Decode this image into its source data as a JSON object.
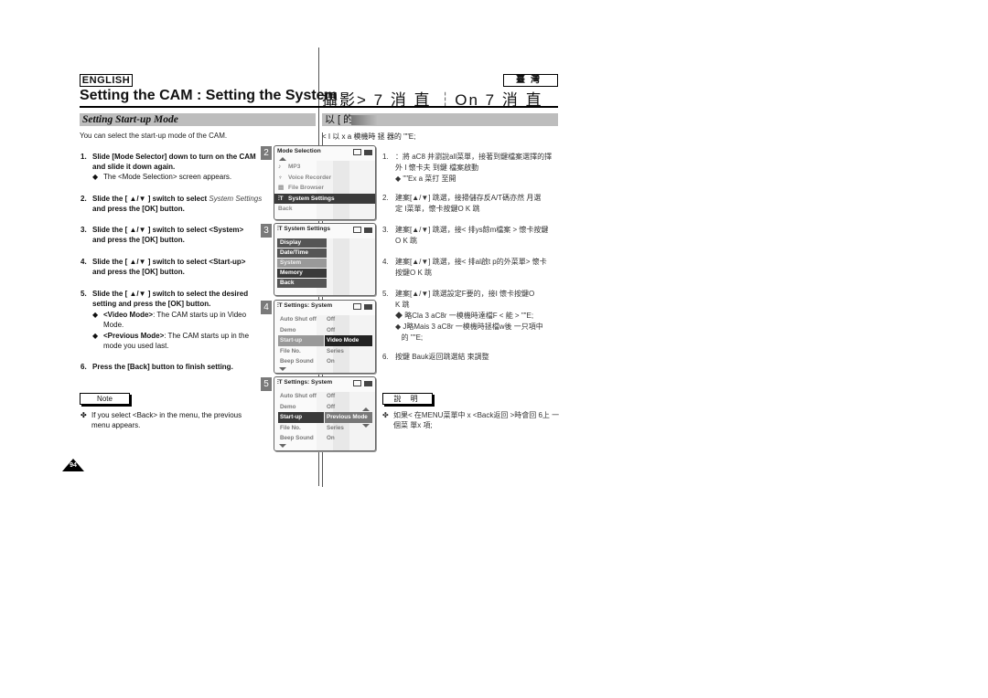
{
  "header": {
    "language_label": "ENGLISH",
    "region_label": "臺灣",
    "title_en": "Setting the CAM : Setting the System",
    "title_zh": "攝影> 7 消 直 ┆On 7 消 直"
  },
  "section": {
    "title_en": "Setting Start-up Mode",
    "title_zh": "以 [ 的"
  },
  "intro": {
    "en": "You can select the start-up mode of the CAM.",
    "zh": "< I 以 x a 模機時 拯 器的 \"\"E;"
  },
  "steps_en": [
    {
      "num": "1.",
      "text": "Slide [Mode Selector] down to turn on the CAM and slide it down again.",
      "sub": [
        "The <Mode Selection> screen appears."
      ]
    },
    {
      "num": "2.",
      "text_prefix": "Slide the [ ▲/▼ ] switch to select ",
      "text_italic": "System Settings",
      "text_suffix": "and press the [OK] button.",
      "sub": []
    },
    {
      "num": "3.",
      "text": "Slide the [ ▲/▼ ] switch to select <System> and press the [OK] button.",
      "sub": []
    },
    {
      "num": "4.",
      "text": "Slide the [ ▲/▼ ] switch to select <Start-up> and press the [OK] button.",
      "sub": []
    },
    {
      "num": "5.",
      "text": "Slide the [ ▲/▼ ] switch to select the desired setting and press the [OK] button.",
      "sub": [
        {
          "bold": "<Video Mode>",
          "rest": ": The CAM starts up in Video Mode."
        },
        {
          "bold": "<Previous Mode>",
          "rest": ": The CAM starts up in the mode you used last."
        }
      ]
    },
    {
      "num": "6.",
      "text": "Press the [Back] button to finish setting.",
      "sub": []
    }
  ],
  "note_en": {
    "label": "Note",
    "bullet": "✤",
    "text": "If you select <Back> in the menu, the previous menu appears."
  },
  "steps_zh": [
    {
      "num": "1.",
      "line1": "：將 aC8 井瀏說all菜單，接著到鍵檔案選擇的擇",
      "line2": "外 I 懷卡夫 到鍵 檔案啟動",
      "sub": "\"\"Ex a 菜打 至開"
    },
    {
      "num": "2.",
      "line1": "建案[▲/▼] 跳選，接掃儲存反A/T碼亦然 月選",
      "line2": "定 I菜單，懷卡按鍵O K 跳"
    },
    {
      "num": "3.",
      "line1": "建案[▲/▼] 跳選，接< 排ys餘m檔案 > 懷卡按鍵",
      "line2": "O K 跳"
    },
    {
      "num": "4.",
      "line1": "建案[▲/▼] 跳選，接< 排al啟t p的外菜單> 懷卡",
      "line2": "按鍵O K 跳"
    },
    {
      "num": "5.",
      "line1": "建案[▲/▼] 跳選設定F要的，接I 懷卡按鍵O",
      "line2": "K 跳",
      "subs": [
        "略Cla 3 aC8r 一模機時達檔F < 能 > \"\"E;",
        "J略Mais 3 aC8r 一模機時拯檔w後 一只項中",
        "的 \"\"E;"
      ]
    },
    {
      "num": "6.",
      "line1": "按鍵 Bauk返回跳選結 束調整",
      "line2": ""
    }
  ],
  "note_zh": {
    "label": "說 明",
    "bullet": "✤",
    "text": "如果< 在MENU菜單中 x <Back返回 >時會回 6上 一個菜 單x 項;"
  },
  "page_number": "94",
  "screens": [
    {
      "badge": "2",
      "title": "Mode Selection",
      "items": [
        {
          "icon": "music-note-icon",
          "glyph": "♪",
          "label": "MP3"
        },
        {
          "icon": "microphone-icon",
          "glyph": "♆",
          "label": "Voice Recorder"
        },
        {
          "icon": "folder-icon",
          "glyph": "▤",
          "label": "File Browser"
        },
        {
          "icon": "settings-icon",
          "glyph": "⫶T",
          "label": "System Settings",
          "selected": true
        },
        {
          "icon": "",
          "glyph": "",
          "label": "Back"
        }
      ]
    },
    {
      "badge": "3",
      "title": "System Settings",
      "menu": [
        "Display",
        "Date/Time",
        "System",
        "Memory",
        "Back"
      ],
      "highlighted": "System"
    },
    {
      "badge": "4",
      "title": "Settings: System",
      "rows": [
        {
          "key": "Auto Shut off",
          "value": "Off"
        },
        {
          "key": "Demo",
          "value": "Off"
        },
        {
          "key": "Start-up",
          "value": "Video Mode",
          "selected": true
        },
        {
          "key": "File No.",
          "value": "Series"
        },
        {
          "key": "Beep Sound",
          "value": "On"
        }
      ]
    },
    {
      "badge": "5",
      "title": "Settings: System",
      "rows": [
        {
          "key": "Auto Shut off",
          "value": "Off"
        },
        {
          "key": "Demo",
          "value": "Off"
        },
        {
          "key": "Start-up",
          "value": "Previous Mode",
          "selected": true
        },
        {
          "key": "File No.",
          "value": "Series"
        },
        {
          "key": "Beep Sound",
          "value": "On"
        }
      ]
    }
  ]
}
